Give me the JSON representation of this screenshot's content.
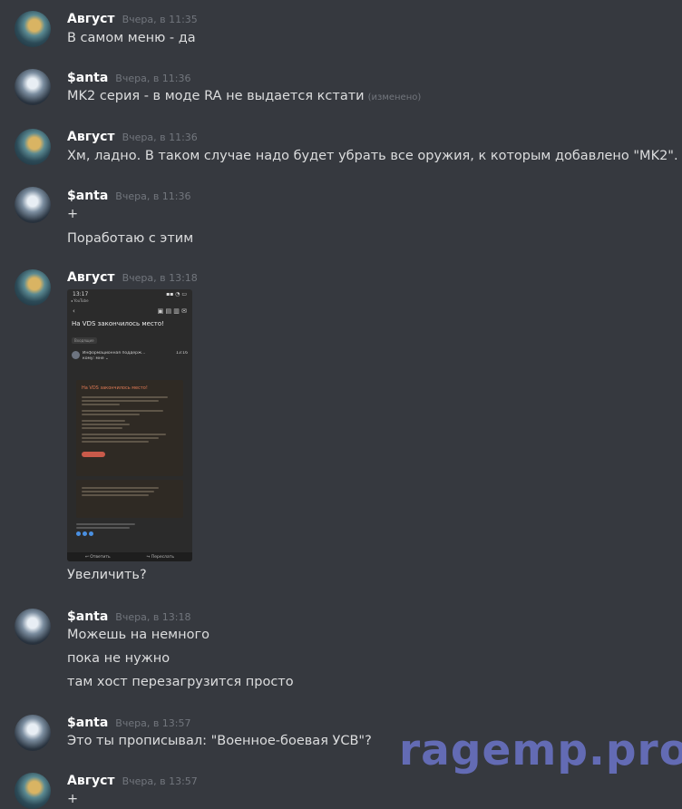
{
  "messages": [
    {
      "author": "Август",
      "time": "Вчера, в 11:35",
      "lines": [
        "В самом меню - да"
      ]
    },
    {
      "author": "$anta",
      "time": "Вчера, в 11:36",
      "lines": [
        "MK2 серия - в моде RA не выдается кстати"
      ],
      "edited": "(изменено)"
    },
    {
      "author": "Август",
      "time": "Вчера, в 11:36",
      "lines": [
        "Хм, ладно. В таком случае надо будет убрать все оружия, к которым добавлено \"MK2\"."
      ]
    },
    {
      "author": "$anta",
      "time": "Вчера, в 11:36",
      "lines": [
        "+",
        "Поработаю с этим"
      ]
    },
    {
      "author": "Август",
      "time": "Вчера, в 13:18",
      "lines": [
        "Увеличить?"
      ]
    },
    {
      "author": "$anta",
      "time": "Вчера, в 13:18",
      "lines": [
        "Можешь на немного",
        "пока не нужно",
        "там хост перезагрузится просто"
      ]
    },
    {
      "author": "$anta",
      "time": "Вчера, в 13:57",
      "lines": [
        "Это ты прописывал: \"Военное-боевая УСВ\"?"
      ]
    },
    {
      "author": "Август",
      "time": "Вчера, в 13:57",
      "lines": [
        "+"
      ]
    }
  ],
  "attachment": {
    "status_time": "13:17",
    "app": "◂ YouTube",
    "subject": "На VDS закончилось место!",
    "folder": "Входящие",
    "sender": "Информационная поддерж...",
    "sender_time": "13:16",
    "recipient": "кому: мне ⌄",
    "card_title": "На VDS закончилось место!",
    "reply": "↩ Ответить",
    "forward": "↪ Переслать"
  },
  "watermark": "ragemp.pro"
}
